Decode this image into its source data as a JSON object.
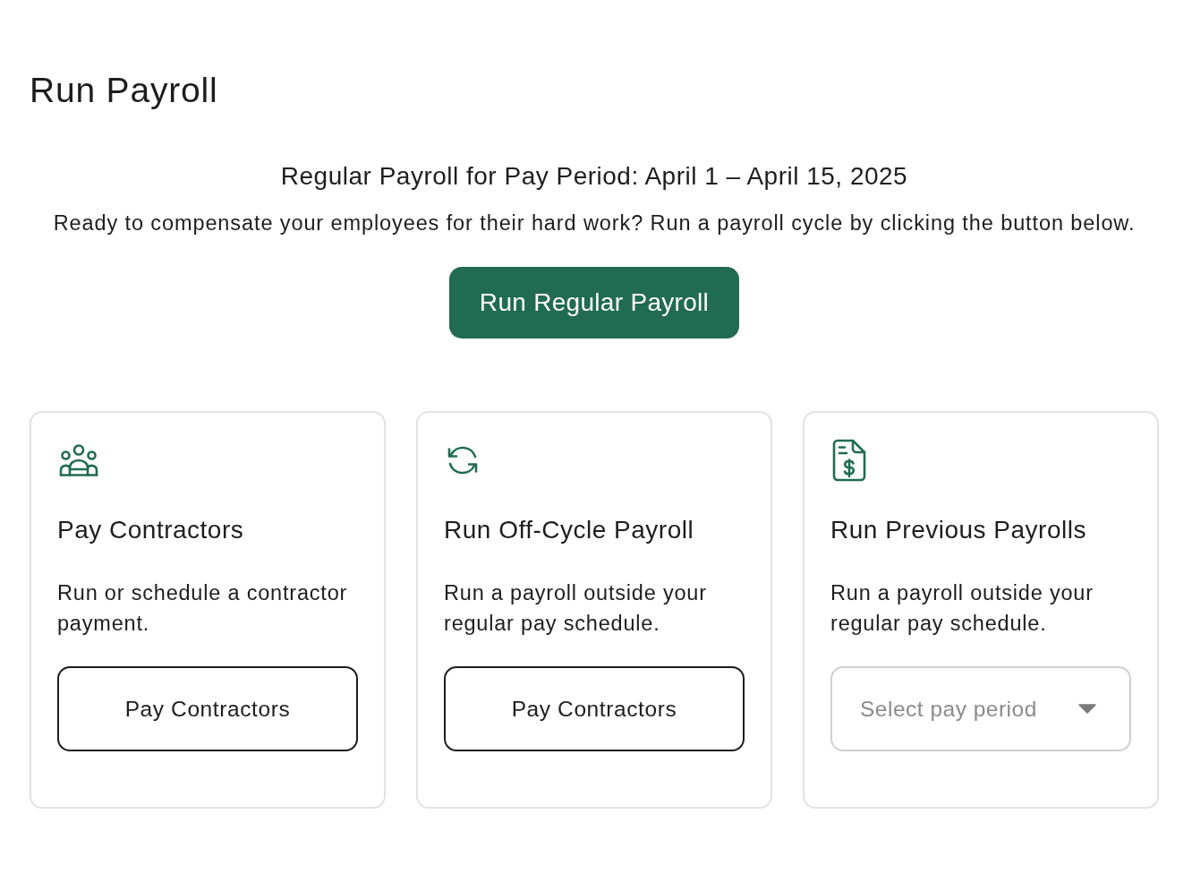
{
  "page": {
    "title": "Run Payroll"
  },
  "regular_payroll": {
    "heading": "Regular Payroll for Pay Period: April 1 – April 15, 2025",
    "description": "Ready to compensate your employees for their hard work? Run a payroll cycle by clicking the button below.",
    "button": "Run Regular Payroll"
  },
  "cards": [
    {
      "kind": "button",
      "title": "Pay Contractors",
      "description": "Run or schedule a contractor payment.",
      "button": "Pay Contractors"
    },
    {
      "kind": "button",
      "title": "Run Off-Cycle Payroll",
      "description": "Run a payroll outside your regular pay schedule.",
      "button": "Pay Contractors"
    },
    {
      "kind": "select",
      "title": "Run Previous Payrolls",
      "description": "Run a payroll outside your regular pay schedule.",
      "placeholder": "Select pay period"
    }
  ]
}
